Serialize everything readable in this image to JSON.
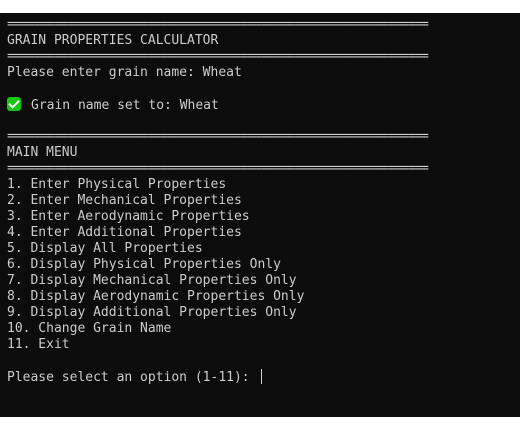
{
  "separator": "===============================================================",
  "header": {
    "title": "GRAIN PROPERTIES CALCULATOR"
  },
  "prompts": {
    "grain_name": "Please enter grain name: Wheat",
    "grain_set": "Grain name set to: Wheat",
    "select_option": "Please select an option (1-11): "
  },
  "menu": {
    "title": "MAIN MENU",
    "items": [
      "1. Enter Physical Properties",
      "2. Enter Mechanical Properties",
      "3. Enter Aerodynamic Properties",
      "4. Enter Additional Properties",
      "5. Display All Properties",
      "6. Display Physical Properties Only",
      "7. Display Mechanical Properties Only",
      "8. Display Aerodynamic Properties Only",
      "9. Display Additional Properties Only",
      "10. Change Grain Name",
      "11. Exit"
    ]
  },
  "icons": {
    "success": "check-mark-icon"
  },
  "colors": {
    "background": "#0c0c0c",
    "text": "#cccccc",
    "success": "#16c60c"
  }
}
